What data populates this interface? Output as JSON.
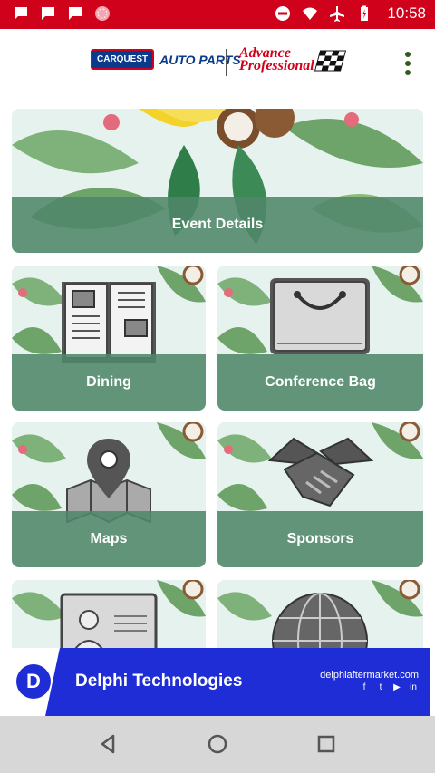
{
  "status_bar": {
    "time": "10:58",
    "left_icons": [
      "message-icon",
      "message-icon",
      "message-icon",
      "circle-pattern-icon"
    ],
    "right_icons": [
      "do-not-disturb-icon",
      "wifi-icon",
      "airplane-mode-icon",
      "battery-charging-icon"
    ]
  },
  "header": {
    "carquest_badge": "CARQUEST",
    "carquest_text": "AUTO PARTS",
    "advance_line1": "Advance",
    "advance_line2": "Professional",
    "menu_icon": "more-vert-icon"
  },
  "tiles": {
    "event_details": "Event Details",
    "dining": "Dining",
    "conference_bag": "Conference Bag",
    "maps": "Maps",
    "sponsors": "Sponsors"
  },
  "banner": {
    "logo_letter": "D",
    "brand": "Delphi Technologies",
    "url": "delphiaftermarket.com",
    "social": [
      "f",
      "t",
      "▶",
      "in"
    ]
  },
  "navbar": {
    "buttons": [
      "back-icon",
      "home-icon",
      "recents-icon"
    ]
  },
  "colors": {
    "status_bar": "#d0021b",
    "tile_label_bar": "#50866a",
    "banner_blue": "#1e2dd6",
    "nav_bar": "#d7d7d7"
  }
}
